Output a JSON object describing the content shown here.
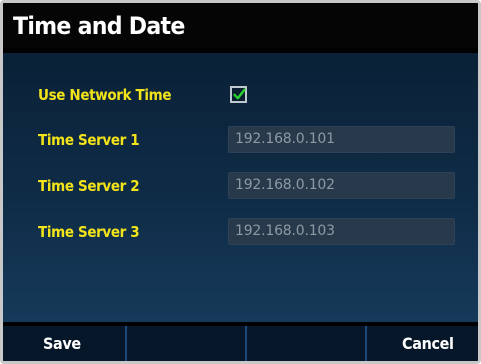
{
  "title": "Time and Date",
  "settings": {
    "use_network_time": {
      "label": "Use Network Time",
      "checked": true
    },
    "servers": [
      {
        "label": "Time Server 1",
        "value": "192.168.0.101"
      },
      {
        "label": "Time Server 2",
        "value": "192.168.0.102"
      },
      {
        "label": "Time Server 3",
        "value": "192.168.0.103"
      }
    ]
  },
  "softkeys": [
    {
      "label": "Save"
    },
    {
      "label": ""
    },
    {
      "label": ""
    },
    {
      "label": "Cancel"
    }
  ],
  "colors": {
    "label_yellow": "#f2e31a",
    "check_green": "#29d22f",
    "field_bg": "#27394b"
  }
}
